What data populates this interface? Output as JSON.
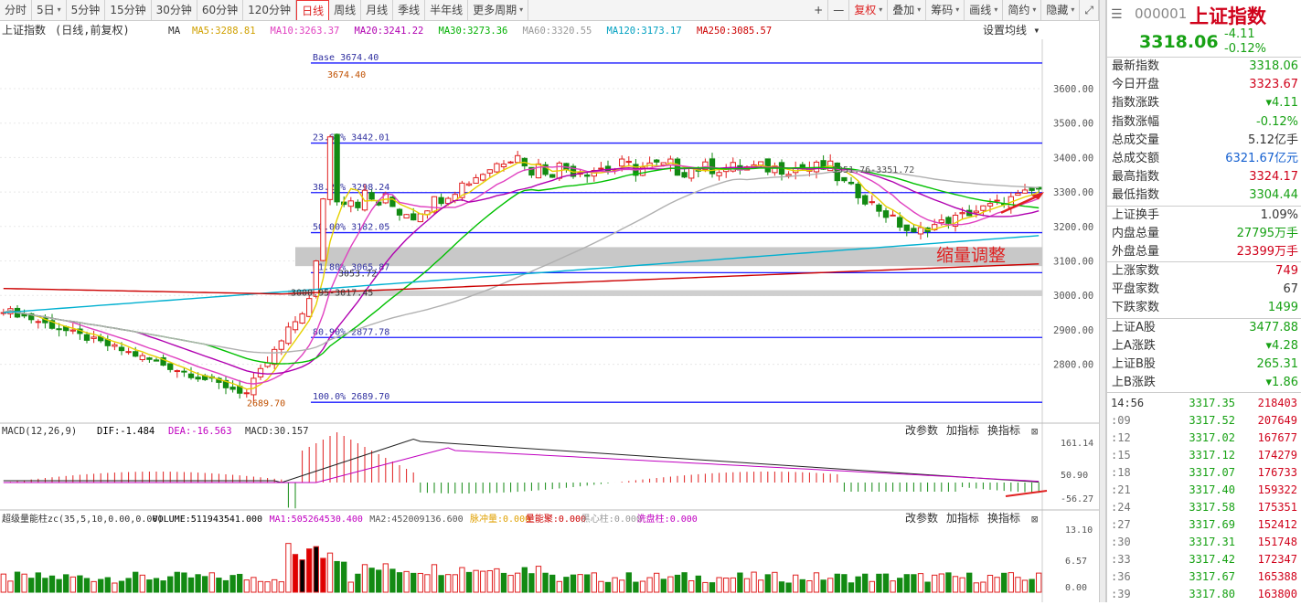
{
  "toolbar": {
    "tabs": [
      "分时",
      "5日",
      "5分钟",
      "15分钟",
      "30分钟",
      "60分钟",
      "120分钟",
      "日线",
      "周线",
      "月线",
      "季线",
      "半年线",
      "更多周期"
    ],
    "active": "日线",
    "right": [
      "+",
      "—",
      "复权",
      "叠加",
      "筹码",
      "画线",
      "简约",
      "隐藏"
    ]
  },
  "chart_header": {
    "name": "上证指数",
    "mode": "(日线,前复权)",
    "ma_label": "MA",
    "ma": [
      {
        "t": "MA5:3288.81",
        "c": "#d0a000"
      },
      {
        "t": "MA10:3263.37",
        "c": "#e040c0"
      },
      {
        "t": "MA20:3241.22",
        "c": "#b000b0"
      },
      {
        "t": "MA30:3273.36",
        "c": "#00b000"
      },
      {
        "t": "MA60:3320.55",
        "c": "#999999"
      },
      {
        "t": "MA120:3173.17",
        "c": "#00a0c0"
      },
      {
        "t": "MA250:3085.57",
        "c": "#cc0000"
      }
    ],
    "setting": "设置均线"
  },
  "price_axis": [
    "3600.00",
    "3500.00",
    "3400.00",
    "3300.00",
    "3200.00",
    "3100.00",
    "3000.00",
    "2900.00",
    "2800.00"
  ],
  "fib": [
    {
      "label": "Base 3674.40",
      "v": 3674.4
    },
    {
      "label": "23.60% 3442.01",
      "v": 3442.01
    },
    {
      "label": "38.20% 3298.24",
      "v": 3298.24
    },
    {
      "label": "50.00% 3182.05",
      "v": 3182.05
    },
    {
      "label": "61.80% 3065.87",
      "v": 3065.87
    },
    {
      "label": "80.90% 2877.78",
      "v": 2877.78
    },
    {
      "label": "100.0% 2689.70",
      "v": 2689.7
    }
  ],
  "annotations": {
    "high": "3674.40",
    "low": "2689.70",
    "range": "3351.76-3351.72",
    "gap1": "3053.72",
    "gap2": "3000.95-3017.45",
    "note": "缩量调整"
  },
  "macd": {
    "header": [
      "MACD(12,26,9)",
      "DIF:-1.484",
      "DEA:-16.563",
      "MACD:30.157"
    ],
    "axis": [
      "161.14",
      "50.90",
      "-56.27"
    ],
    "buttons": [
      "改参数",
      "加指标",
      "换指标"
    ]
  },
  "vol": {
    "header": [
      "超级量能柱zc(35,5,10,0.00,0.00)",
      "VOLUME:511943541.000",
      "MA1:505264530.400",
      "MA2:452009136.600",
      "脉冲量:0.000",
      "量能聚:0.000",
      "黑心柱:0.000",
      "洗盘柱:0.000"
    ],
    "axis": [
      "13.10",
      "6.57",
      "0.00"
    ],
    "buttons": [
      "改参数",
      "加指标",
      "换指标"
    ]
  },
  "quote": {
    "code": "000001",
    "name": "上证指数",
    "price": "3318.06",
    "chg": "-4.11",
    "pct": "-0.12%"
  },
  "stats1": [
    [
      "最新指数",
      "3318.06",
      "green"
    ],
    [
      "今日开盘",
      "3323.67",
      "red"
    ],
    [
      "指数涨跌",
      "▾4.11",
      "green"
    ],
    [
      "指数涨幅",
      "-0.12%",
      "green"
    ],
    [
      "总成交量",
      "5.12亿手",
      ""
    ],
    [
      "总成交额",
      "6321.67亿元",
      "blue"
    ],
    [
      "最高指数",
      "3324.17",
      "red"
    ],
    [
      "最低指数",
      "3304.44",
      "green"
    ]
  ],
  "stats2": [
    [
      "上证换手",
      "1.09%",
      ""
    ],
    [
      "内盘总量",
      "27795万手",
      "green"
    ],
    [
      "外盘总量",
      "23399万手",
      "red"
    ]
  ],
  "stats3": [
    [
      "上涨家数",
      "749",
      "red"
    ],
    [
      "平盘家数",
      "67",
      ""
    ],
    [
      "下跌家数",
      "1499",
      "green"
    ]
  ],
  "stats4": [
    [
      "上证A股",
      "3477.88",
      "green"
    ],
    [
      "上A涨跌",
      "▾4.28",
      "green"
    ],
    [
      "上证B股",
      "265.31",
      "green"
    ],
    [
      "上B涨跌",
      "▾1.86",
      "green"
    ]
  ],
  "ticks": [
    [
      "14:56",
      "3317.35",
      "218403"
    ],
    [
      ":09",
      "3317.52",
      "207649"
    ],
    [
      ":12",
      "3317.02",
      "167677"
    ],
    [
      ":15",
      "3317.12",
      "174279"
    ],
    [
      ":18",
      "3317.07",
      "176733"
    ],
    [
      ":21",
      "3317.40",
      "159322"
    ],
    [
      ":24",
      "3317.58",
      "175351"
    ],
    [
      ":27",
      "3317.69",
      "152412"
    ],
    [
      ":30",
      "3317.31",
      "151748"
    ],
    [
      ":33",
      "3317.42",
      "172347"
    ],
    [
      ":36",
      "3317.67",
      "165388"
    ],
    [
      ":39",
      "3317.80",
      "163800"
    ]
  ]
}
